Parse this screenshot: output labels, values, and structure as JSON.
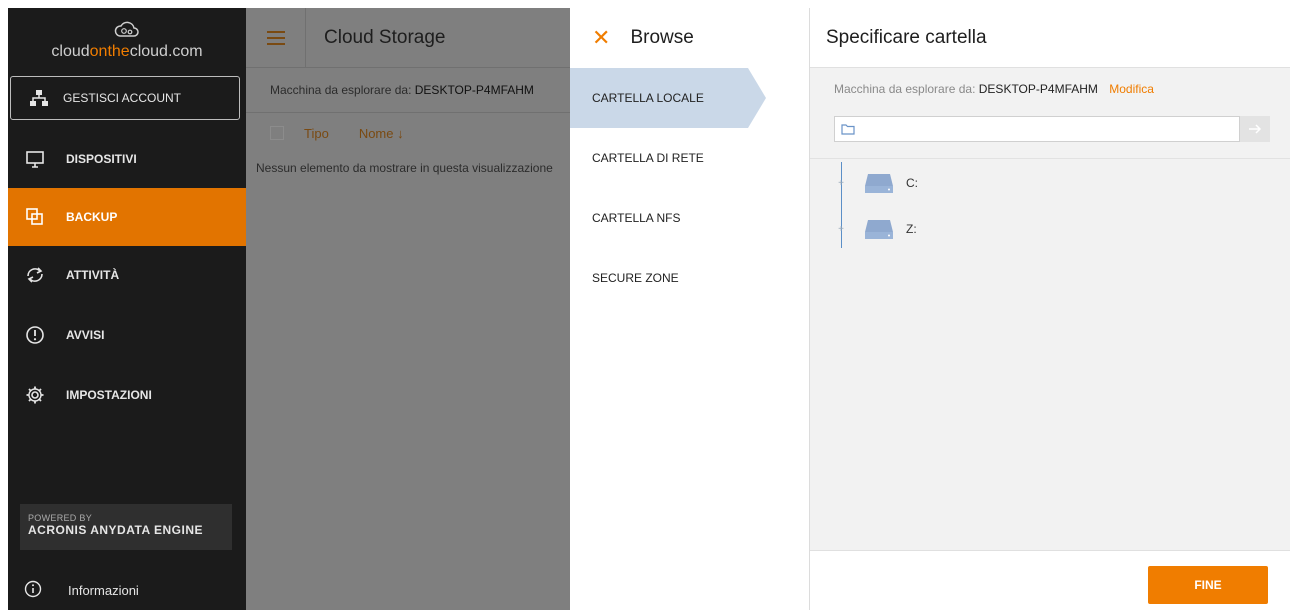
{
  "sidebar": {
    "logo": {
      "prefix": "cloud",
      "accent": "onthe",
      "suffix": "cloud.com"
    },
    "manage_label": "GESTISCI ACCOUNT",
    "items": [
      {
        "label": "DISPOSITIVI",
        "icon": "monitor-icon"
      },
      {
        "label": "BACKUP",
        "icon": "backup-icon",
        "active": true
      },
      {
        "label": "ATTIVITÀ",
        "icon": "sync-icon"
      },
      {
        "label": "AVVISI",
        "icon": "alert-icon"
      },
      {
        "label": "IMPOSTAZIONI",
        "icon": "gear-icon"
      }
    ],
    "powered": {
      "line1": "POWERED BY",
      "line2": "ACRONIS ANYDATA ENGINE"
    },
    "info_label": "Informazioni"
  },
  "main": {
    "title": "Cloud Storage",
    "machine_prefix": "Macchina da esplorare da:",
    "machine_name": "DESKTOP-P4MFAHM",
    "columns": [
      "Tipo",
      "Nome ↓"
    ],
    "empty_text": "Nessun elemento da mostrare in questa visualizzazione"
  },
  "browse": {
    "title": "Browse",
    "locations": [
      {
        "label": "CARTELLA LOCALE",
        "active": true
      },
      {
        "label": "CARTELLA DI RETE"
      },
      {
        "label": "CARTELLA NFS"
      },
      {
        "label": "SECURE ZONE"
      }
    ]
  },
  "right": {
    "title": "Specificare cartella",
    "machine_prefix": "Macchina da esplorare da:",
    "machine_name": "DESKTOP-P4MFAHM",
    "edit_label": "Modifica",
    "path_value": "",
    "drives": [
      {
        "label": "C:"
      },
      {
        "label": "Z:"
      }
    ],
    "done_label": "FINE"
  },
  "colors": {
    "accent": "#f07d00",
    "sidebar_bg": "#1b1b1b",
    "active_location": "#cad8e8"
  }
}
